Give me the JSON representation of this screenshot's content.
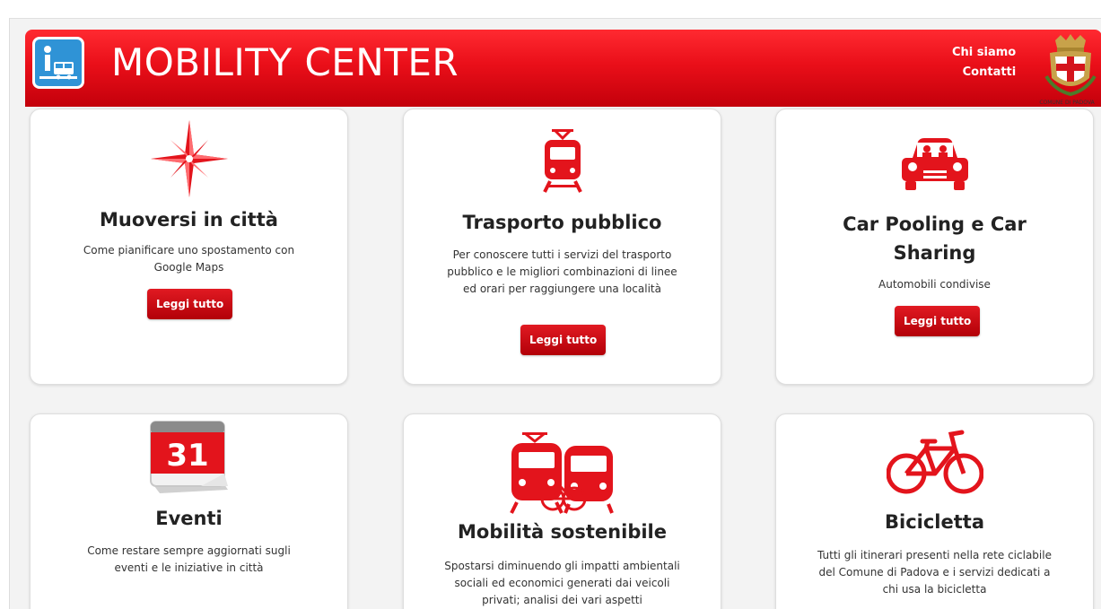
{
  "header": {
    "title": "MOBILITY CENTER",
    "links": [
      "Chi siamo",
      "Contatti"
    ],
    "crest_caption": "COMUNE DI PADOVA"
  },
  "cards": [
    {
      "icon": "compass-rose-icon",
      "title": "Muoversi in città",
      "description": "Come pianificare uno spostamento con Google Maps",
      "button": "Leggi tutto"
    },
    {
      "icon": "tram-icon",
      "title": "Trasporto pubblico",
      "description": "Per conoscere tutti i servizi del trasporto pubblico e le migliori combinazioni di linee ed orari per raggiungere una località",
      "button": "Leggi tutto"
    },
    {
      "icon": "car-icon",
      "title": "Car Pooling e Car Sharing",
      "description": "Automobili condivise",
      "button": "Leggi tutto"
    },
    {
      "icon": "calendar-icon",
      "title": "Eventi",
      "description": "Come restare sempre aggiornati sugli eventi e le iniziative in città",
      "calendar_day": "31"
    },
    {
      "icon": "sustainable-mobility-icon",
      "title": "Mobilità sostenibile",
      "description": "Spostarsi diminuendo gli impatti ambientali sociali ed economici generati dai veicoli privati; analisi dei vari aspetti"
    },
    {
      "icon": "bicycle-icon",
      "title": "Bicicletta",
      "description": "Tutti gli itinerari presenti nella rete ciclabile del Comune di Padova e i servizi dedicati a chi usa la bicicletta"
    }
  ],
  "colors": {
    "brand_red": "#e3141c",
    "button_red": "#c4000c",
    "logo_blue": "#2f93d6"
  }
}
